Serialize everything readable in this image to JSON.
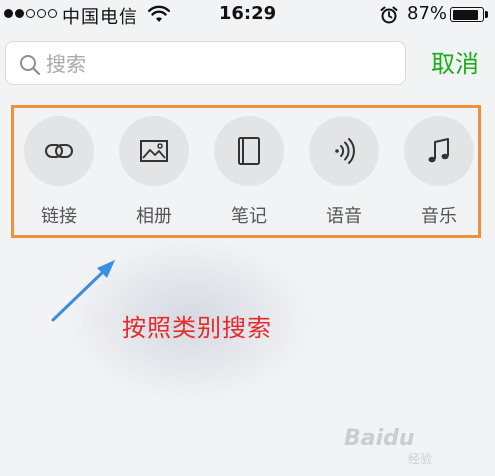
{
  "status_bar": {
    "carrier": "中国电信",
    "time": "16:29",
    "battery_percent": "87%",
    "battery_level": 0.87,
    "signal_bars": 2,
    "signal_total": 5
  },
  "search": {
    "placeholder": "搜索",
    "value": ""
  },
  "cancel_label": "取消",
  "categories": [
    {
      "label": "链接",
      "icon": "link-icon"
    },
    {
      "label": "相册",
      "icon": "image-icon"
    },
    {
      "label": "笔记",
      "icon": "notebook-icon"
    },
    {
      "label": "语音",
      "icon": "voice-icon"
    },
    {
      "label": "音乐",
      "icon": "music-icon"
    }
  ],
  "annotation": {
    "text": "按照类别搜索"
  },
  "watermark": {
    "text": "Baidu",
    "subtext": "经验"
  },
  "colors": {
    "accent_green": "#1aad19",
    "highlight_orange": "#f0913a",
    "annotation_red": "#e52a2a",
    "arrow_blue": "#3b8ee0"
  }
}
